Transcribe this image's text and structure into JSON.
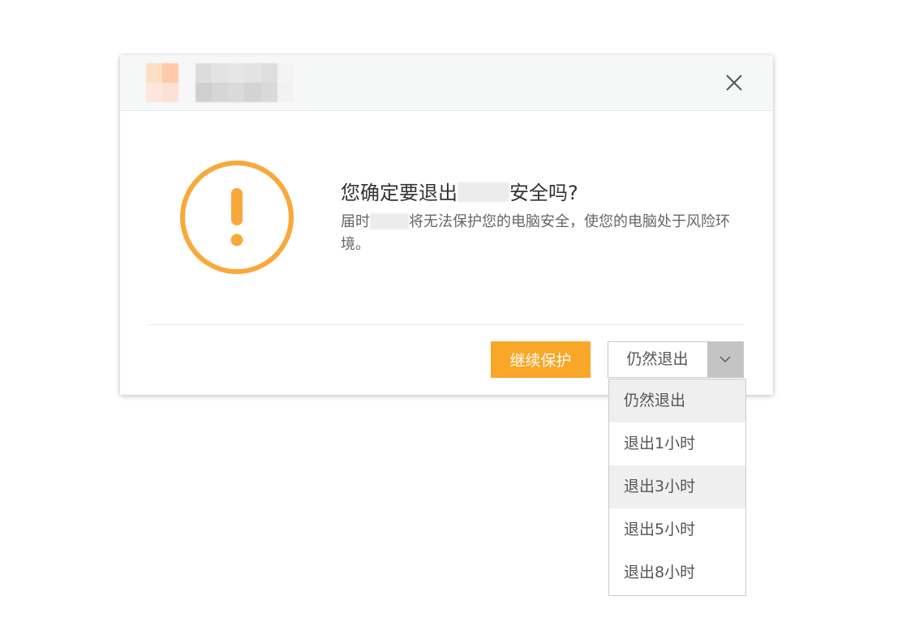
{
  "dialog": {
    "message_title_before": "您确定要退出",
    "message_title_after": "安全吗?",
    "message_body_prefix": "届时",
    "message_body_rest": "将无法保护您的电脑安全，使您的电脑处于风险环境。",
    "close_icon": "close-icon",
    "warning_icon": "exclamation-circle-icon"
  },
  "buttons": {
    "continue_label": "继续保护",
    "exit_label": "仍然退出",
    "dropdown_icon": "chevron-down-icon"
  },
  "dropdown": {
    "items": [
      {
        "label": "仍然退出"
      },
      {
        "label": "退出1小时"
      },
      {
        "label": "退出3小时"
      },
      {
        "label": "退出5小时"
      },
      {
        "label": "退出8小时"
      }
    ]
  },
  "colors": {
    "accent": "#faa628",
    "warning_icon": "#f9a83a",
    "menu_highlight": "#efefef"
  }
}
